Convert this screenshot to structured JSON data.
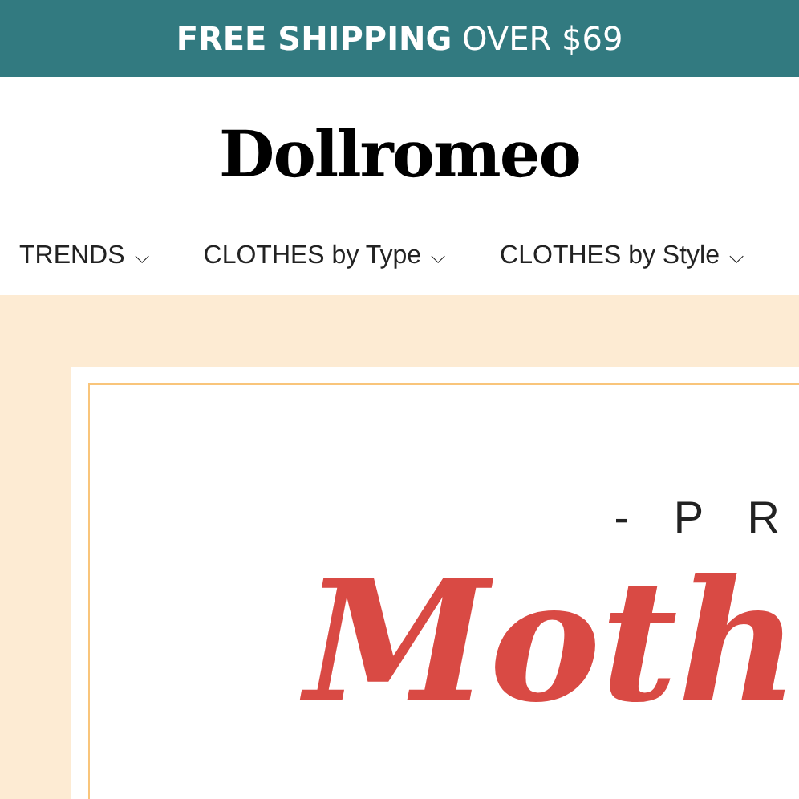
{
  "announcement_bar": {
    "text": "**FREE SHIPPING** OVER $69"
  },
  "logo": {
    "text": "Dollromeo"
  },
  "nav": [
    {
      "label": "TRENDS",
      "caret": "⌵"
    },
    {
      "label": "CLOTHES by Type",
      "caret": "⌵"
    },
    {
      "label": "CLOTHES by Style",
      "caret": "⌵"
    }
  ],
  "banner": {
    "kicker": "- P R",
    "headline": "Moth"
  }
}
